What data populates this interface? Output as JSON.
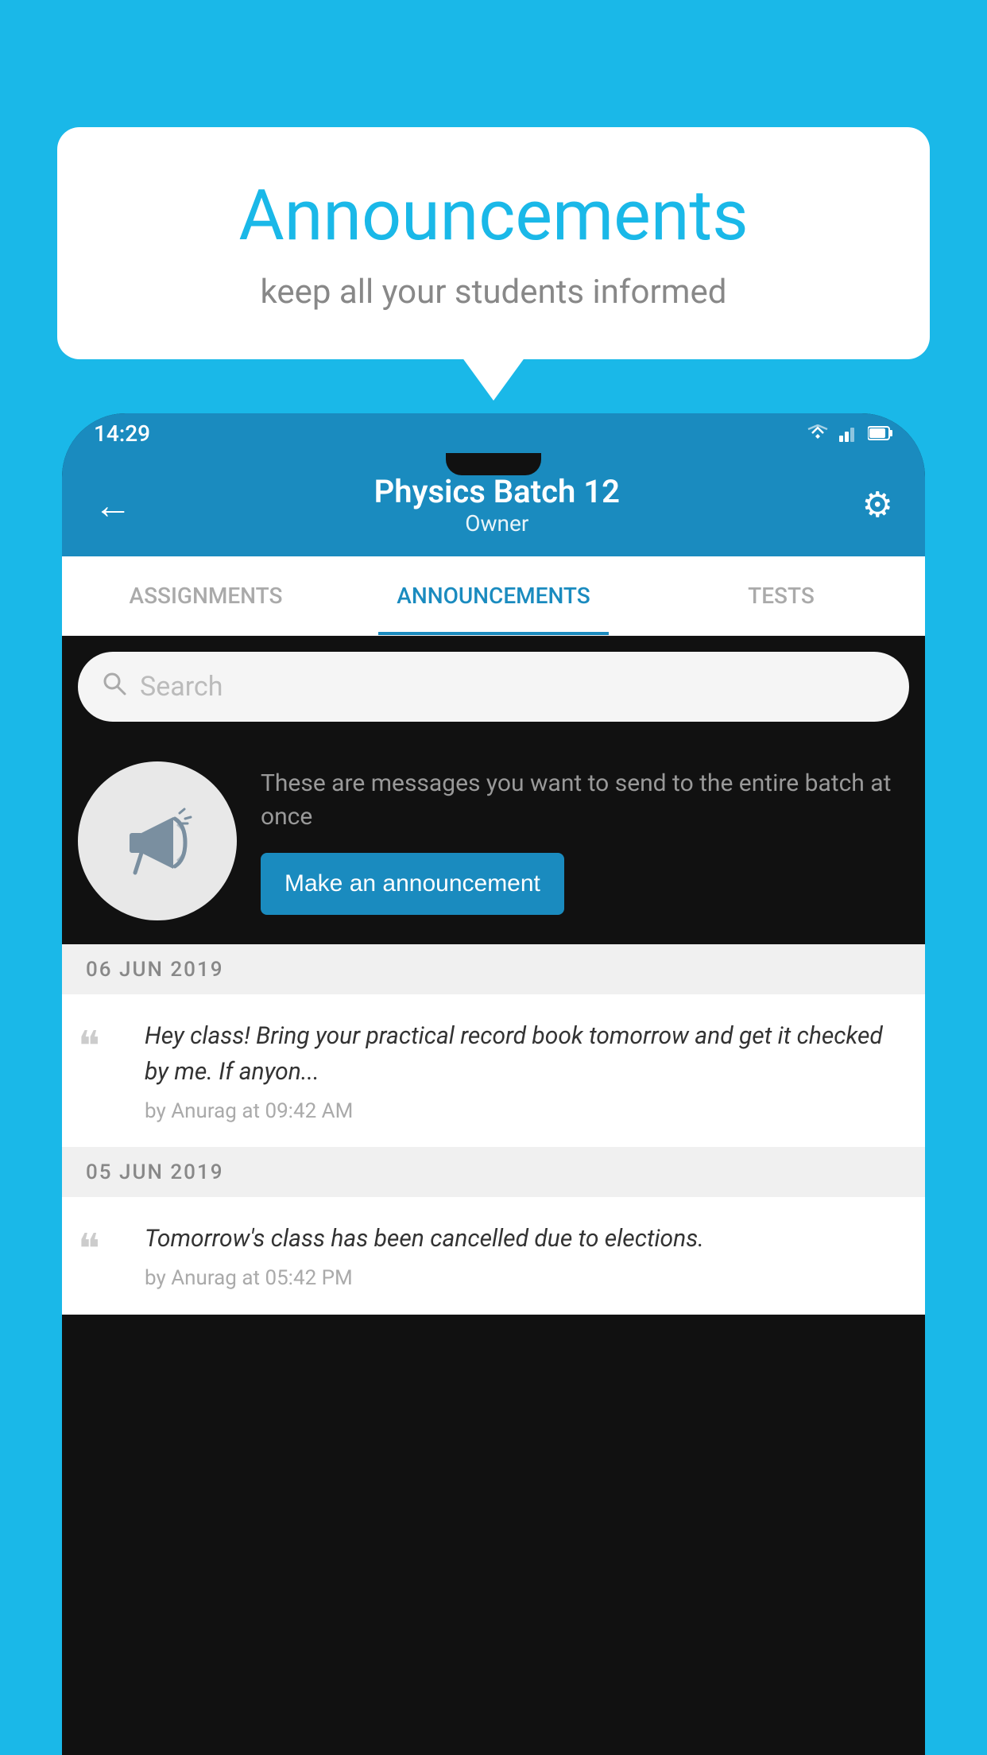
{
  "background_color": "#1ab8e8",
  "speech_bubble": {
    "title": "Announcements",
    "subtitle": "keep all your students informed",
    "title_color": "#1ab8e8",
    "subtitle_color": "#888888"
  },
  "phone": {
    "status_bar": {
      "time": "14:29",
      "icons": [
        "wifi",
        "signal",
        "battery"
      ]
    },
    "app_bar": {
      "back_label": "←",
      "title": "Physics Batch 12",
      "subtitle": "Owner",
      "settings_label": "⚙"
    },
    "tabs": [
      {
        "label": "ASSIGNMENTS",
        "active": false
      },
      {
        "label": "ANNOUNCEMENTS",
        "active": true
      },
      {
        "label": "TESTS",
        "active": false
      }
    ],
    "search": {
      "placeholder": "Search"
    },
    "empty_state": {
      "description": "These are messages you want to send to the entire batch at once",
      "button_label": "Make an announcement"
    },
    "announcements": [
      {
        "date": "06  JUN  2019",
        "text": "Hey class! Bring your practical record book tomorrow and get it checked by me. If anyon...",
        "meta": "by Anurag at 09:42 AM"
      },
      {
        "date": "05  JUN  2019",
        "text": "Tomorrow's class has been cancelled due to elections.",
        "meta": "by Anurag at 05:42 PM"
      }
    ]
  }
}
